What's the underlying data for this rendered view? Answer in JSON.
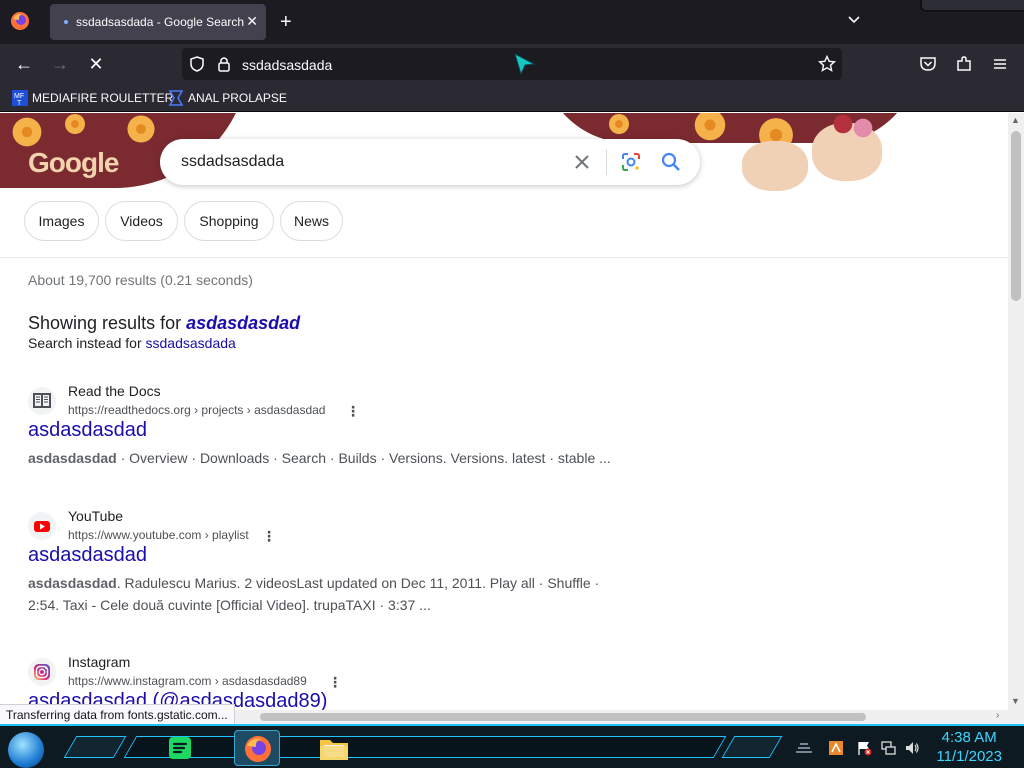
{
  "browser": {
    "tab_title": "ssdadsasdada - Google Search",
    "url": "ssdadsasdada",
    "bookmarks": [
      "MEDIAFIRE ROULETTER",
      "ANAL PROLAPSE"
    ],
    "status_text": "Transferring data from fonts.gstatic.com..."
  },
  "search": {
    "query": "ssdadsasdada",
    "logo_text": "Google",
    "chips": [
      "Images",
      "Videos",
      "Shopping",
      "News"
    ],
    "stats": "About 19,700 results (0.21 seconds)",
    "showing_prefix": "Showing results for",
    "showing_term": "asdasdasdad",
    "instead_prefix": "Search instead for",
    "instead_term": "ssdadsasdada"
  },
  "results": [
    {
      "site": "Read the Docs",
      "cite": "https://readthedocs.org › projects › asdasdasdad",
      "title": "asdasdasdad",
      "snippet_bold": "asdasdasdad",
      "snippet": " · Overview · Downloads · Search · Builds · Versions. Versions. latest · stable ..."
    },
    {
      "site": "YouTube",
      "cite": "https://www.youtube.com › playlist",
      "title": "asdasdasdad",
      "snippet_bold": "asdasdasdad",
      "snippet": ". Radulescu Marius. 2 videosLast updated on Dec 11, 2011. Play all · Shuffle · 2:54. Taxi - Cele două cuvinte [Official Video]. trupaTAXI · 3:37 ..."
    },
    {
      "site": "Instagram",
      "cite": "https://www.instagram.com › asdasdasdad89",
      "title": "asdasdasdad (@asdasdasdad89)"
    }
  ],
  "taskbar": {
    "time": "4:38 AM",
    "date": "11/1/2023"
  },
  "colors": {
    "link": "#1a0dab",
    "banner": "#7b2a2f",
    "taskbar_accent": "#1ec4ff"
  }
}
